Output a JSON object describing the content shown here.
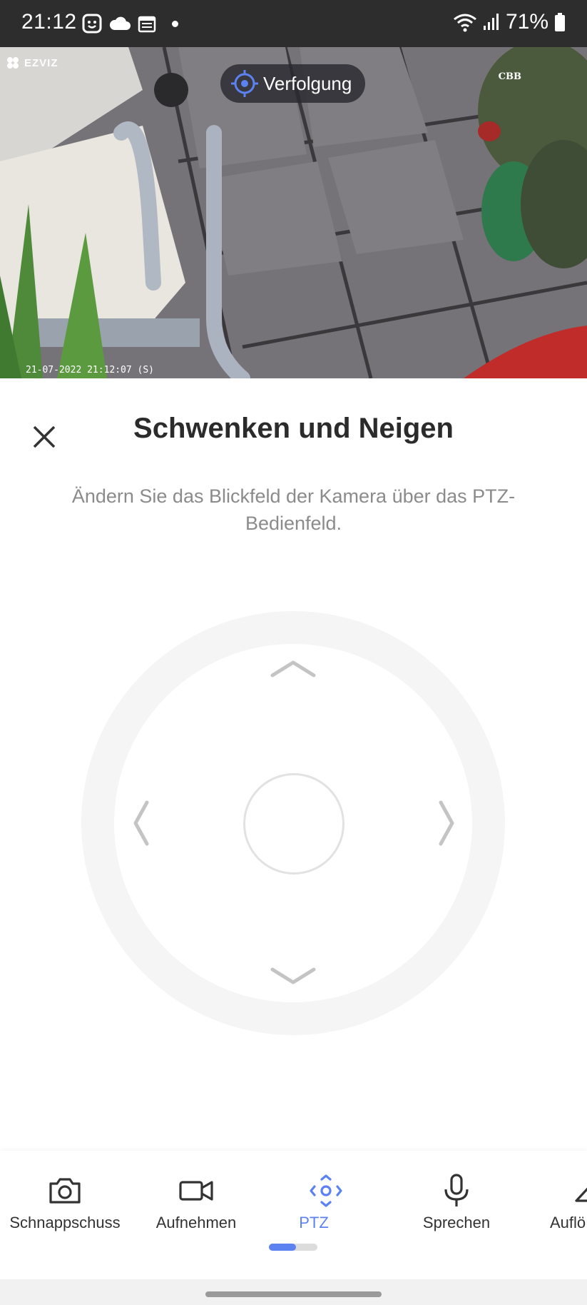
{
  "status_bar": {
    "time": "21:12",
    "battery": "71%",
    "icons_left": [
      "face-notification-icon",
      "cloud-icon",
      "calendar-icon",
      "dot-icon"
    ],
    "icons_right": [
      "wifi-icon",
      "signal-icon",
      "battery-icon"
    ]
  },
  "camera": {
    "logo": "EZVIZ",
    "timestamp": "21-07-2022 21:12:07  (S)",
    "watermark": "CBB",
    "tracking_label": "Verfolgung"
  },
  "panel": {
    "title": "Schwenken und Neigen",
    "description": "Ändern Sie das Blickfeld der Kamera über das PTZ-Bedienfeld."
  },
  "toolbar": {
    "items": [
      {
        "label": "Schnappschuss",
        "icon": "camera-icon"
      },
      {
        "label": "Aufnehmen",
        "icon": "video-icon"
      },
      {
        "label": "PTZ",
        "icon": "ptz-icon",
        "active": true
      },
      {
        "label": "Sprechen",
        "icon": "microphone-icon"
      },
      {
        "label": "Auflö",
        "icon": "resolution-icon"
      }
    ],
    "page_indicator": {
      "active_fraction": 0.56
    }
  },
  "colors": {
    "accent": "#5b82f0",
    "statusbar_bg": "#2d2d2d",
    "title_text": "#2b2b2b",
    "desc_text": "#8b8b8b"
  }
}
